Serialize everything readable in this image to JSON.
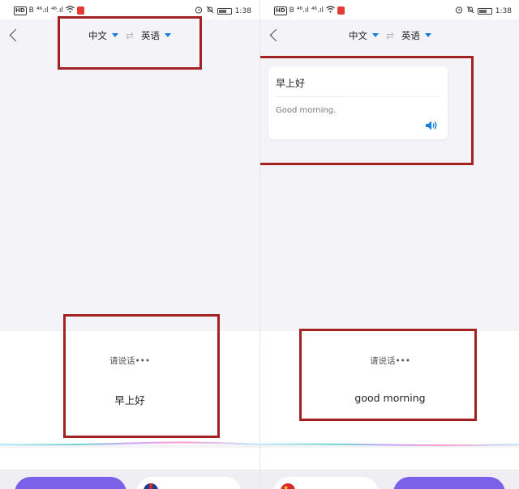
{
  "status_bar": {
    "hd": "HD",
    "b": "B",
    "signal_1": "⁴⁶.ıl",
    "signal_2": "⁴⁶.ıl",
    "time": "1:38"
  },
  "header": {
    "source_lang": "中文",
    "target_lang": "英语",
    "swap_symbol": "⇄"
  },
  "left_screen": {
    "prompt": "请说话•••",
    "recognized": "早上好"
  },
  "right_screen": {
    "card": {
      "source_text": "早上好",
      "translated_text": "Good morning."
    },
    "prompt": "请说话•••",
    "recognized": "good morning"
  },
  "colors": {
    "accent_blue": "#1a7cd9",
    "button_purple": "#7b61e7",
    "highlight_red": "#a32121"
  },
  "icons": [
    "back-icon",
    "chevron-down-icon",
    "swap-icon",
    "speaker-icon",
    "alarm-icon",
    "mute-icon",
    "wifi-icon",
    "battery-icon",
    "mic-icon"
  ]
}
